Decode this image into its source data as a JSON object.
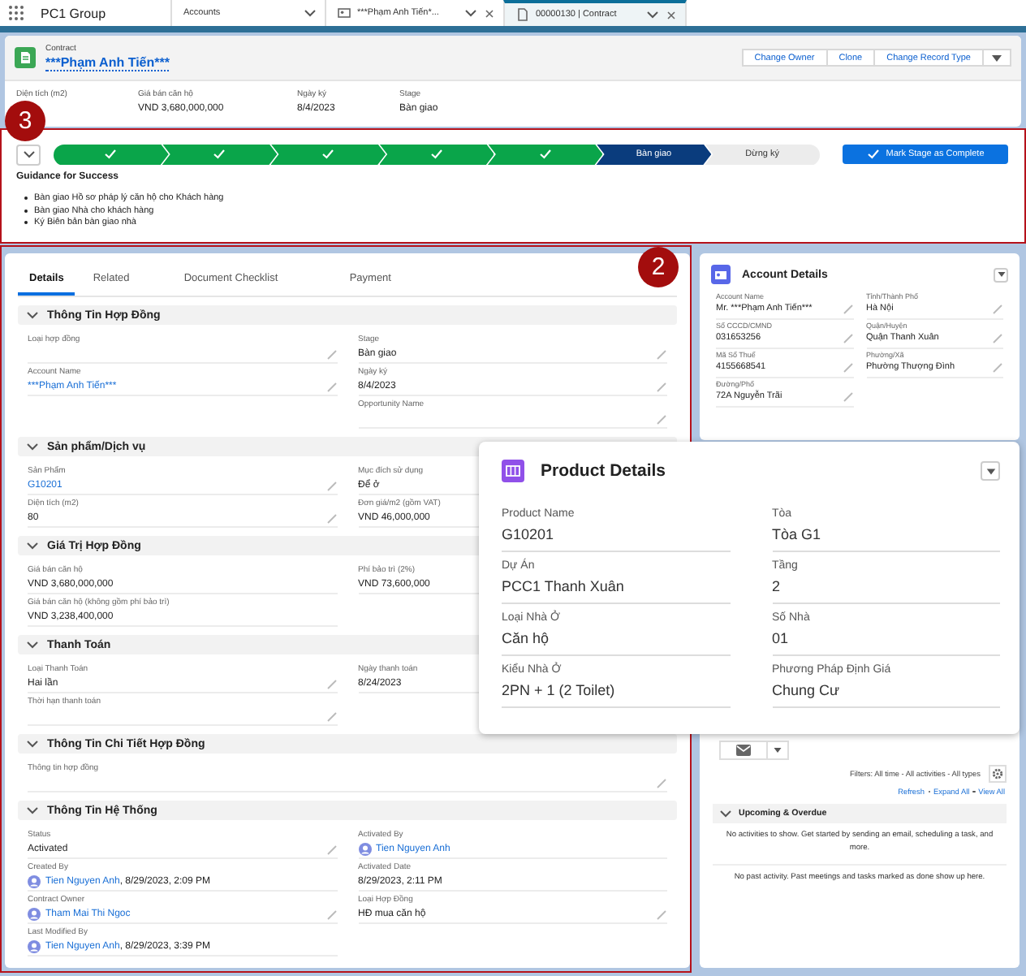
{
  "app": {
    "name": "PC1 Group"
  },
  "nav_tabs": [
    {
      "label": "Accounts",
      "kind": "plain",
      "selected": false,
      "closable": false
    },
    {
      "label": "***Phạm Anh Tiến*...",
      "kind": "account",
      "selected": false,
      "closable": true
    },
    {
      "label": "00000130 | Contract",
      "kind": "contract",
      "selected": true,
      "closable": true
    }
  ],
  "record": {
    "object": "Contract",
    "title": "***Phạm Anh Tiến***",
    "actions": [
      "Change Owner",
      "Clone",
      "Change Record Type"
    ],
    "highlights": [
      {
        "label": "Diện tích (m2)"
      },
      {
        "label": "Giá bán căn hộ",
        "value": "VND 3,680,000,000"
      },
      {
        "label": "Ngày ký",
        "value": "8/4/2023"
      },
      {
        "label": "Stage",
        "value": "Bàn giao"
      }
    ]
  },
  "path": {
    "annotation": "3",
    "stages": [
      {
        "kind": "complete"
      },
      {
        "kind": "complete"
      },
      {
        "kind": "complete"
      },
      {
        "kind": "complete"
      },
      {
        "kind": "complete"
      },
      {
        "kind": "current",
        "label": "Bàn giao"
      },
      {
        "kind": "incomplete",
        "label": "Dừng ký"
      }
    ],
    "action": "Mark Stage as Complete",
    "guidance_title": "Guidance for Success",
    "guidance": [
      "Bàn giao Hồ sơ pháp lý căn hộ cho Khách hàng",
      "Bàn giao Nhà cho khách hàng",
      "Ký Biên bản bàn giao nhà"
    ]
  },
  "details": {
    "annotation": "2",
    "tabs": [
      {
        "label": "Details",
        "selected": true
      },
      {
        "label": "Related",
        "selected": false
      },
      {
        "label": "Document Checklist",
        "selected": false
      },
      {
        "label": "Payment",
        "selected": false
      }
    ],
    "sections": [
      {
        "title": "Thông Tin Hợp Đồng",
        "expanded": true,
        "left": [
          {
            "label": "Loại hợp đồng",
            "editable": true
          },
          {
            "label": "Account Name",
            "value": "***Phạm Anh Tiến***",
            "kind": "link",
            "editable": true
          }
        ],
        "right": [
          {
            "label": "Stage",
            "value": "Bàn giao",
            "kind": "text",
            "editable": true
          },
          {
            "label": "Ngày ký",
            "value": "8/4/2023",
            "kind": "text",
            "editable": true
          },
          {
            "label": "Opportunity Name",
            "editable": true
          }
        ]
      },
      {
        "title": "Sản phẩm/Dịch vụ",
        "expanded": true,
        "left": [
          {
            "label": "Sản Phẩm",
            "value": "G10201",
            "kind": "link",
            "editable": true
          },
          {
            "label": "Diện tích (m2)",
            "value": "80",
            "kind": "text",
            "editable": true
          }
        ],
        "right": [
          {
            "label": "Mục đích sử dụng",
            "value": "Để ở",
            "kind": "text",
            "editable": false
          },
          {
            "label": "Đơn giá/m2 (gồm VAT)",
            "value": "VND 46,000,000",
            "kind": "text",
            "editable": false
          }
        ]
      },
      {
        "title": "Giá Trị Hợp Đồng",
        "expanded": true,
        "left": [
          {
            "label": "Giá bán căn hộ",
            "value": "VND 3,680,000,000",
            "kind": "text",
            "editable": false
          },
          {
            "label": "Giá bán căn hộ (không gồm phí bảo trì)",
            "value": "VND 3,238,400,000",
            "kind": "text",
            "editable": false
          }
        ],
        "right": [
          {
            "label": "Phí bảo trì (2%)",
            "value": "VND 73,600,000",
            "kind": "text",
            "editable": false
          }
        ]
      },
      {
        "title": "Thanh Toán",
        "expanded": true,
        "left": [
          {
            "label": "Loại Thanh Toán",
            "value": "Hai lần",
            "kind": "text",
            "editable": true
          },
          {
            "label": "Thời hạn thanh toán",
            "editable": true
          }
        ],
        "right": [
          {
            "label": "Ngày thanh toán",
            "value": "8/24/2023",
            "kind": "text",
            "editable": false
          }
        ]
      },
      {
        "title": "Thông Tin Chi Tiết Hợp Đồng",
        "expanded": true,
        "wide": [
          {
            "label": "Thông tin hợp đồng",
            "editable": true
          }
        ]
      },
      {
        "title": "Thông Tin Hệ Thống",
        "expanded": true,
        "left": [
          {
            "label": "Status",
            "value": "Activated",
            "kind": "text",
            "editable": true
          },
          {
            "label": "Created By",
            "value": "Tien Nguyen Anh",
            "kind": "user",
            "detail": ", 8/29/2023, 2:09 PM",
            "editable": false
          },
          {
            "label": "Contract Owner",
            "value": "Tham Mai Thi Ngoc",
            "kind": "user",
            "editable": true
          },
          {
            "label": "Last Modified By",
            "value": "Tien Nguyen Anh",
            "kind": "user",
            "detail": ", 8/29/2023, 3:39 PM",
            "editable": false
          }
        ],
        "right": [
          {
            "label": "Activated By",
            "value": "Tien Nguyen Anh",
            "kind": "user",
            "editable": false
          },
          {
            "label": "Activated Date",
            "value": "8/29/2023, 2:11 PM",
            "kind": "text",
            "editable": false
          },
          {
            "label": "Loại Hợp Đồng",
            "value": "HĐ mua căn hộ",
            "kind": "text",
            "editable": true
          }
        ]
      }
    ]
  },
  "account_details": {
    "title": "Account Details",
    "left": [
      {
        "label": "Account Name",
        "value": "Mr. ***Phạm Anh Tiến***",
        "editable": true
      },
      {
        "label": "Số CCCD/CMND",
        "value": "031653256",
        "editable": true
      },
      {
        "label": "Mã Số Thuế",
        "value": "4155668541",
        "editable": true
      },
      {
        "label": "Đường/Phố",
        "value": "72A Nguyễn Trãi",
        "editable": true
      }
    ],
    "right": [
      {
        "label": "Tỉnh/Thành Phố",
        "value": "Hà Nội",
        "editable": true
      },
      {
        "label": "Quận/Huyện",
        "value": "Quận Thanh Xuân",
        "editable": true
      },
      {
        "label": "Phường/Xã",
        "value": "Phường Thượng Đình",
        "editable": true
      }
    ]
  },
  "product_details": {
    "title": "Product Details",
    "left": [
      {
        "label": "Product Name",
        "value": "G10201"
      },
      {
        "label": "Dự Án",
        "value": "PCC1 Thanh Xuân"
      },
      {
        "label": "Loại Nhà Ở",
        "value": "Căn hộ"
      },
      {
        "label": "Kiểu Nhà Ở",
        "value": "2PN + 1 (2 Toilet)"
      }
    ],
    "right": [
      {
        "label": "Tòa",
        "value": "Tòa G1"
      },
      {
        "label": "Tầng",
        "value": "2"
      },
      {
        "label": "Số Nhà",
        "value": "01"
      },
      {
        "label": "Phương Pháp Định Giá",
        "value": "Chung Cư"
      }
    ]
  },
  "activity": {
    "filters": "Filters: All time - All activities - All types",
    "links": [
      "Refresh",
      "Expand All",
      "View All"
    ],
    "upcoming": {
      "title": "Upcoming & Overdue",
      "expanded": true,
      "empty": "No activities to show. Get started by sending an email, scheduling a task, and more."
    },
    "past_empty": "No past activity. Past meetings and tasks marked as done show up here."
  }
}
